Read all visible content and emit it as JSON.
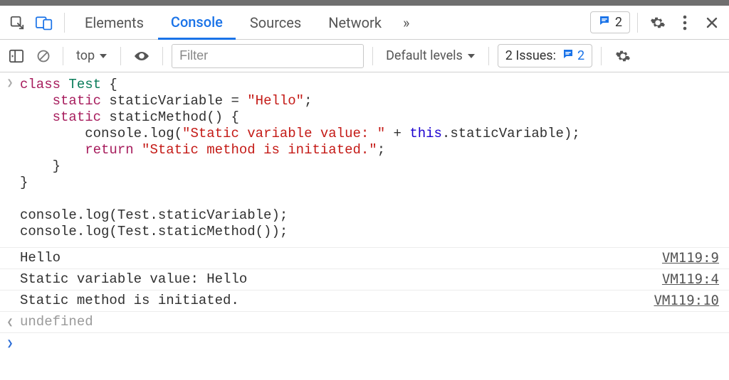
{
  "tabs": {
    "elements": "Elements",
    "console": "Console",
    "sources": "Sources",
    "network": "Network"
  },
  "overflow_glyph": "»",
  "msg_count": "2",
  "toolbar": {
    "context": "top",
    "filter_placeholder": "Filter",
    "levels": "Default levels",
    "issues_label": "2 Issues:",
    "issues_count": "2"
  },
  "code": {
    "l1a": "class",
    "l1b": "Test",
    "l1c": " {",
    "l2a": "    ",
    "l2b": "static",
    "l2c": " staticVariable = ",
    "l2d": "\"Hello\"",
    "l2e": ";",
    "l3a": "    ",
    "l3b": "static",
    "l3c": " staticMethod() {",
    "l4a": "        console.log(",
    "l4b": "\"Static variable value: \"",
    "l4c": " + ",
    "l4d": "this",
    "l4e": ".staticVariable);",
    "l5a": "        ",
    "l5b": "return",
    "l5c": " ",
    "l5d": "\"Static method is initiated.\"",
    "l5e": ";",
    "l6": "    }",
    "l7": "}",
    "blank": "",
    "l8": "console.log(Test.staticVariable);",
    "l9": "console.log(Test.staticMethod());"
  },
  "out": {
    "r1": "Hello",
    "r1src": "VM119:9",
    "r2": "Static variable value: Hello",
    "r2src": "VM119:4",
    "r3": "Static method is initiated.",
    "r3src": "VM119:10",
    "ret": "undefined"
  }
}
